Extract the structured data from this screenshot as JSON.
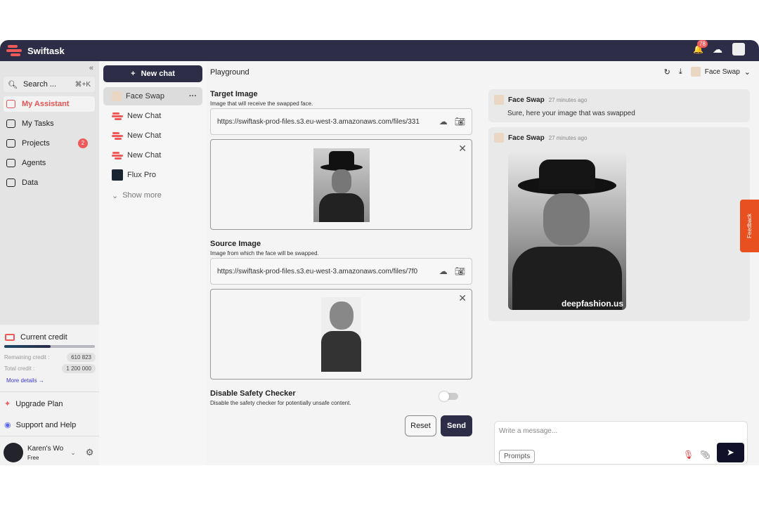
{
  "header": {
    "app_name": "Swiftask",
    "notification_count": "78"
  },
  "sidebar": {
    "search_label": "Search ...",
    "search_shortcut": "⌘+K",
    "items": [
      {
        "label": "My Assistant"
      },
      {
        "label": "My Tasks"
      },
      {
        "label": "Projects",
        "badge": "2"
      },
      {
        "label": "Agents"
      },
      {
        "label": "Data"
      }
    ],
    "credit": {
      "title": "Current credit",
      "remaining_label": "Remaining credit :",
      "remaining": "610 823",
      "total_label": "Total credit :",
      "total": "1 200 000",
      "progress": 0.51,
      "more": "More details"
    },
    "upgrade": "Upgrade Plan",
    "support": "Support and Help",
    "user": {
      "name": "Karen's Wo",
      "plan": "Free"
    }
  },
  "chats": {
    "new_chat": "New chat",
    "items": [
      {
        "label": "Face Swap"
      },
      {
        "label": "New Chat"
      },
      {
        "label": "New Chat"
      },
      {
        "label": "New Chat"
      },
      {
        "label": "Flux Pro"
      }
    ],
    "show_more": "Show more"
  },
  "main": {
    "title": "Playground",
    "agent": "Face Swap",
    "target": {
      "label": "Target Image",
      "desc": "Image that will receive the swapped face.",
      "url": "https://swiftask-prod-files.s3.eu-west-3.amazonaws.com/files/331"
    },
    "source": {
      "label": "Source Image",
      "desc": "Image from which the face will be swapped.",
      "url": "https://swiftask-prod-files.s3.eu-west-3.amazonaws.com/files/7f0"
    },
    "safety": {
      "label": "Disable Safety Checker",
      "desc": "Disable the safety checker for potentially unsafe content.",
      "enabled": false
    },
    "reset": "Reset",
    "send": "Send"
  },
  "conversation": {
    "messages": [
      {
        "author": "Face Swap",
        "time": "27 minutes ago",
        "text": "Sure, here your image that was swapped"
      },
      {
        "author": "Face Swap",
        "time": "27 minutes ago",
        "watermark": "deepfashion.us"
      }
    ],
    "placeholder": "Write a message...",
    "prompts": "Prompts"
  },
  "feedback": "Feedback"
}
